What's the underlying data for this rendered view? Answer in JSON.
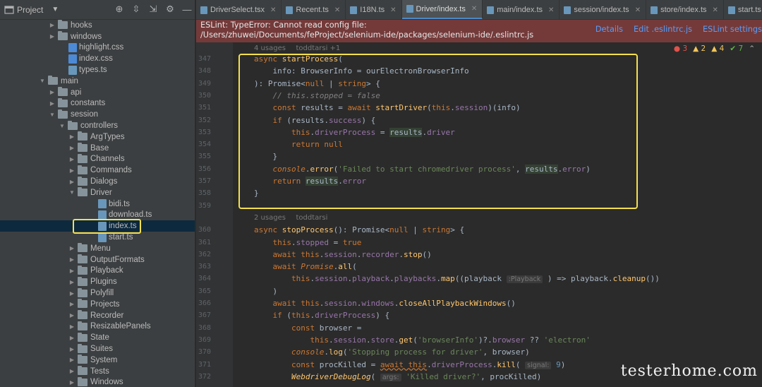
{
  "project": {
    "title": "Project"
  },
  "tree": [
    {
      "label": "hooks",
      "depth": 4,
      "type": "folder",
      "arrow": "closed"
    },
    {
      "label": "windows",
      "depth": 4,
      "type": "folder",
      "arrow": "closed"
    },
    {
      "label": "highlight.css",
      "depth": 5,
      "type": "css"
    },
    {
      "label": "index.css",
      "depth": 5,
      "type": "css"
    },
    {
      "label": "types.ts",
      "depth": 5,
      "type": "ts"
    },
    {
      "label": "main",
      "depth": 3,
      "type": "folder",
      "arrow": "open"
    },
    {
      "label": "api",
      "depth": 4,
      "type": "folder",
      "arrow": "closed"
    },
    {
      "label": "constants",
      "depth": 4,
      "type": "folder",
      "arrow": "closed"
    },
    {
      "label": "session",
      "depth": 4,
      "type": "folder",
      "arrow": "open"
    },
    {
      "label": "controllers",
      "depth": 5,
      "type": "folder",
      "arrow": "open"
    },
    {
      "label": "ArgTypes",
      "depth": 6,
      "type": "folder",
      "arrow": "closed"
    },
    {
      "label": "Base",
      "depth": 6,
      "type": "folder",
      "arrow": "closed"
    },
    {
      "label": "Channels",
      "depth": 6,
      "type": "folder",
      "arrow": "closed"
    },
    {
      "label": "Commands",
      "depth": 6,
      "type": "folder",
      "arrow": "closed"
    },
    {
      "label": "Dialogs",
      "depth": 6,
      "type": "folder",
      "arrow": "closed"
    },
    {
      "label": "Driver",
      "depth": 6,
      "type": "folder",
      "arrow": "open"
    },
    {
      "label": "bidi.ts",
      "depth": 8,
      "type": "ts"
    },
    {
      "label": "download.ts",
      "depth": 8,
      "type": "ts"
    },
    {
      "label": "index.ts",
      "depth": 8,
      "type": "ts",
      "selected": true
    },
    {
      "label": "start.ts",
      "depth": 8,
      "type": "ts"
    },
    {
      "label": "Menu",
      "depth": 6,
      "type": "folder",
      "arrow": "closed"
    },
    {
      "label": "OutputFormats",
      "depth": 6,
      "type": "folder",
      "arrow": "closed"
    },
    {
      "label": "Playback",
      "depth": 6,
      "type": "folder",
      "arrow": "closed"
    },
    {
      "label": "Plugins",
      "depth": 6,
      "type": "folder",
      "arrow": "closed"
    },
    {
      "label": "Polyfill",
      "depth": 6,
      "type": "folder",
      "arrow": "closed"
    },
    {
      "label": "Projects",
      "depth": 6,
      "type": "folder",
      "arrow": "closed"
    },
    {
      "label": "Recorder",
      "depth": 6,
      "type": "folder",
      "arrow": "closed"
    },
    {
      "label": "ResizablePanels",
      "depth": 6,
      "type": "folder",
      "arrow": "closed"
    },
    {
      "label": "State",
      "depth": 6,
      "type": "folder",
      "arrow": "closed"
    },
    {
      "label": "Suites",
      "depth": 6,
      "type": "folder",
      "arrow": "closed"
    },
    {
      "label": "System",
      "depth": 6,
      "type": "folder",
      "arrow": "closed"
    },
    {
      "label": "Tests",
      "depth": 6,
      "type": "folder",
      "arrow": "closed"
    },
    {
      "label": "Windows",
      "depth": 6,
      "type": "folder",
      "arrow": "closed"
    }
  ],
  "tabs": [
    {
      "label": "DriverSelect.tsx",
      "active": false
    },
    {
      "label": "Recent.ts",
      "active": false
    },
    {
      "label": "I18N.ts",
      "active": false
    },
    {
      "label": "Driver/index.ts",
      "active": true
    },
    {
      "label": "main/index.ts",
      "active": false
    },
    {
      "label": "session/index.ts",
      "active": false
    },
    {
      "label": "store/index.ts",
      "active": false
    },
    {
      "label": "start.ts",
      "active": false
    }
  ],
  "banner": {
    "line1": "ESLint: TypeError: Cannot read config file:",
    "line2": "/Users/zhuwei/Documents/feProject/selenium-ide/packages/selenium-ide/.eslintrc.js",
    "details": "Details",
    "edit": "Edit .eslintrc.js",
    "settings": "ESLint settings"
  },
  "inspections": {
    "errors": "3",
    "warnings": "2",
    "weak": "4",
    "ok": "7"
  },
  "usage_hints": [
    "4 usages    toddtarsi +1",
    "2 usages    toddtarsi"
  ],
  "code_lines": [
    {
      "n": "347",
      "html": "<span class='kw'>async</span> <span class='fn'>startProcess</span>("
    },
    {
      "n": "348",
      "html": "    info: BrowserInfo = ourElectronBrowserInfo"
    },
    {
      "n": "349",
      "html": "): Promise&lt;<span class='kw'>null</span> | <span class='kw'>string</span>&gt; {"
    },
    {
      "n": "350",
      "html": "    <span class='cm'>// this.stopped = false</span>"
    },
    {
      "n": "351",
      "html": "    <span class='kw'>const</span> results = <span class='kw'>await</span> <span class='fn'>startDriver</span>(<span class='kw'>this</span>.<span class='fld'>session</span>)(info)"
    },
    {
      "n": "352",
      "html": "    <span class='kw'>if</span> (results.<span class='fld'>success</span>) {"
    },
    {
      "n": "353",
      "html": "        <span class='kw'>this</span>.<span class='fld'>driverProcess</span> = <span class='gl'>results</span>.<span class='fld'>driver</span>"
    },
    {
      "n": "354",
      "html": "        <span class='kw'>return null</span>"
    },
    {
      "n": "355",
      "html": "    }"
    },
    {
      "n": "356",
      "html": "    <span class='it'>console</span>.<span class='fn'>error</span>(<span class='str'>'Failed to start chromedriver process'</span>, <span class='gl'>results</span>.<span class='fld'>error</span>)"
    },
    {
      "n": "357",
      "html": "    <span class='kw'>return</span> <span class='gl'>results</span>.<span class='fld'>error</span>"
    },
    {
      "n": "358",
      "html": "}"
    },
    {
      "n": "359",
      "html": ""
    },
    {
      "n": "",
      "html": ""
    },
    {
      "n": "360",
      "html": "<span class='kw'>async</span> <span class='fn'>stopProcess</span>(): Promise&lt;<span class='kw'>null</span> | <span class='kw'>string</span>&gt; {"
    },
    {
      "n": "361",
      "html": "    <span class='kw'>this</span>.<span class='fld'>stopped</span> = <span class='kw'>true</span>"
    },
    {
      "n": "362",
      "html": "    <span class='kw'>await this</span>.<span class='fld'>session</span>.<span class='fld'>recorder</span>.<span class='fn'>stop</span>()"
    },
    {
      "n": "363",
      "html": "    <span class='kw'>await</span> <span class='it'>Promise</span>.<span class='fn'>all</span>("
    },
    {
      "n": "364",
      "html": "        <span class='kw'>this</span>.<span class='fld'>session</span>.<span class='fld'>playback</span>.<span class='fld'>playbacks</span>.<span class='fn'>map</span>((playback <span class='inl'>:Playback</span> ) =&gt; playback.<span class='fn'>cleanup</span>())"
    },
    {
      "n": "365",
      "html": "    )"
    },
    {
      "n": "366",
      "html": "    <span class='kw'>await this</span>.<span class='fld'>session</span>.<span class='fld'>windows</span>.<span class='fn'>closeAllPlaybackWindows</span>()"
    },
    {
      "n": "367",
      "html": "    <span class='kw'>if</span> (<span class='kw'>this</span>.<span class='fld'>driverProcess</span>) {"
    },
    {
      "n": "368",
      "html": "        <span class='kw'>const</span> browser ="
    },
    {
      "n": "369",
      "html": "            <span class='kw'>this</span>.<span class='fld'>session</span>.<span class='fld'>store</span>.<span class='fn'>get</span>(<span class='str'>'browserInfo'</span>)?.<span class='fld'>browser</span> ?? <span class='str'>'electron'</span>"
    },
    {
      "n": "370",
      "html": "        <span class='it'>console</span>.<span class='fn'>log</span>(<span class='str'>'Stopping process for driver'</span>, browser)"
    },
    {
      "n": "371",
      "html": "        <span class='kw'>const</span> procKilled = <span class='kw' style='text-decoration:underline wavy #cc7832'>await this</span>.<span class='fld'>driverProcess</span>.<span class='fn'>kill</span>( <span class='inl'>signal:</span> <span style='color:#6897bb'>9</span>)"
    },
    {
      "n": "372",
      "html": "        <span class='it' style='color:#ffc66d'>WebdriverDebugLog</span>( <span class='inl'>args:</span> <span class='str'>'Killed driver?'</span>, procKilled)"
    }
  ],
  "watermark": "testerhome.com"
}
